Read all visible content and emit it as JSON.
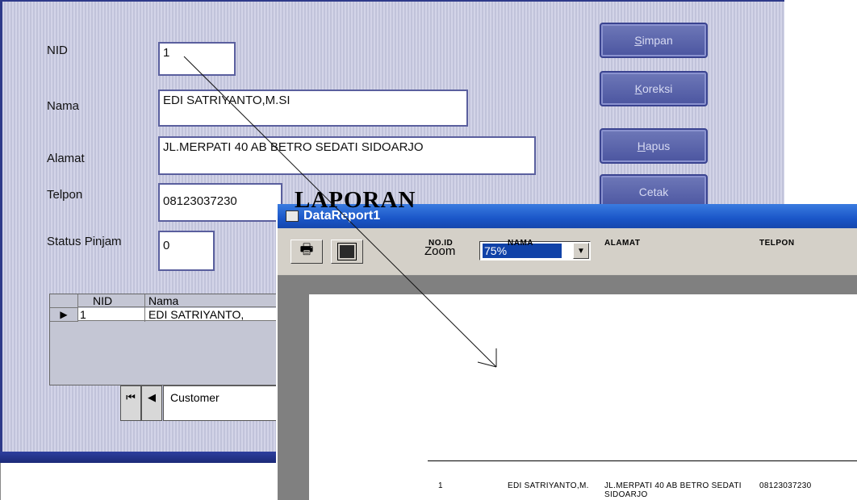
{
  "form": {
    "labels": {
      "nid": "NID",
      "nama": "Nama",
      "alamat": "Alamat",
      "telpon": "Telpon",
      "status": "Status Pinjam"
    },
    "fields": {
      "nid": "1",
      "nama": "EDI SATRIYANTO,M.SI",
      "alamat": "JL.MERPATI 40 AB BETRO SEDATI SIDOARJO",
      "telpon": "08123037230",
      "status": "0"
    },
    "buttons": [
      {
        "accel": "S",
        "rest": "impan"
      },
      {
        "accel": "K",
        "rest": "oreksi"
      },
      {
        "accel": "H",
        "rest": "apus"
      },
      {
        "accel": "",
        "rest": "Cetak"
      }
    ],
    "grid": {
      "headers": [
        "NID",
        "Nama"
      ],
      "row": [
        "1",
        "EDI SATRIYANTO,"
      ],
      "row_pointer": "▶"
    },
    "nav": {
      "first": "⏮",
      "prev": "◀",
      "caption": "Customer"
    },
    "accent": "#2e3a8a"
  },
  "report": {
    "title": "DataReport1",
    "zoom_label": "Zoom",
    "zoom_value": "75%",
    "heading": "LAPORAN",
    "columns": [
      "NO.ID",
      "NAMA",
      "ALAMAT",
      "TELPON"
    ],
    "row": {
      "id": "1",
      "nama": "EDI SATRIYANTO,M.",
      "alamat": "JL.MERPATI 40 AB BETRO SEDATI SIDOARJO",
      "telpon": "08123037230"
    },
    "title_color": "#1a56c8"
  }
}
